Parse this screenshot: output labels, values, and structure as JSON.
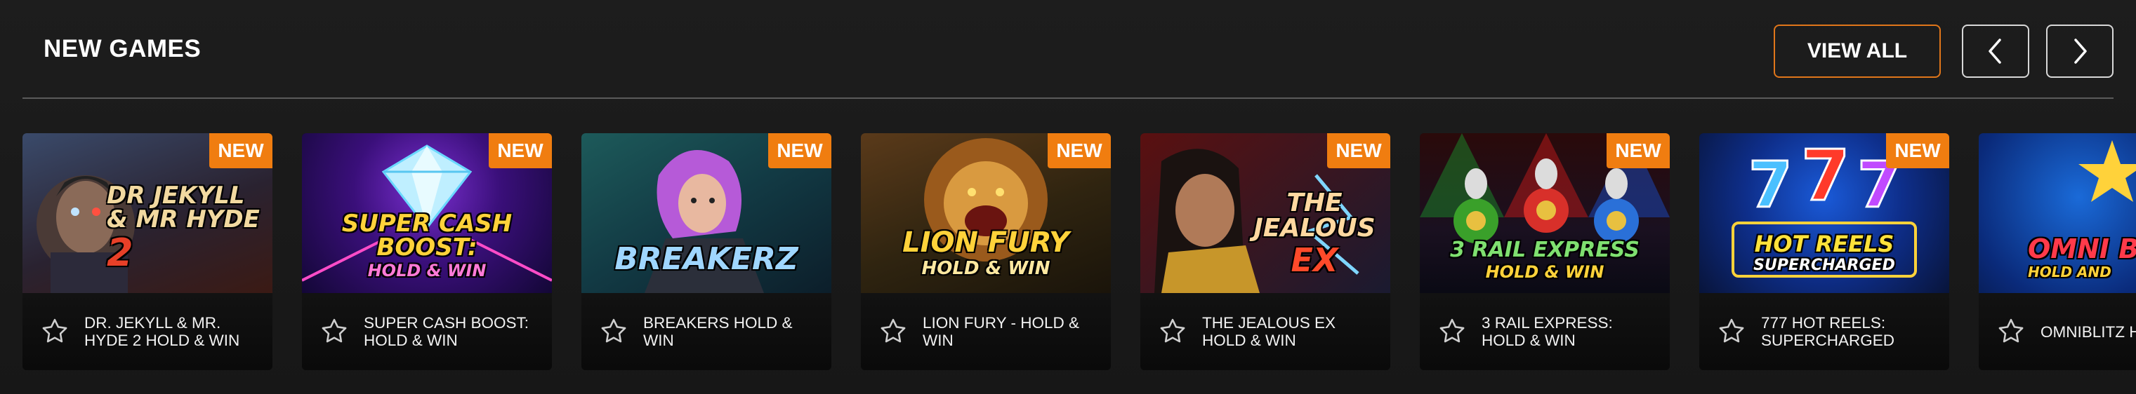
{
  "section": {
    "title": "NEW GAMES",
    "view_all_label": "VIEW ALL",
    "prev_icon": "chevron-left-icon",
    "next_icon": "chevron-right-icon"
  },
  "colors": {
    "accent": "#f07d10",
    "background": "#1a1a1a",
    "card": "#0c0c0c"
  },
  "games": [
    {
      "name": "DR. JEKYLL & MR. HYDE 2 HOLD & WIN",
      "badge": "NEW",
      "art_title": "DR JEKYLL & MR HYDE",
      "art_subtitle": "2",
      "favorite_icon": "star-outline-icon"
    },
    {
      "name": "SUPER CASH BOOST: HOLD & WIN",
      "badge": "NEW",
      "art_title": "SUPER CASH BOOST:",
      "art_subtitle": "HOLD & WIN",
      "favorite_icon": "star-outline-icon"
    },
    {
      "name": "BREAKERS HOLD & WIN",
      "badge": "NEW",
      "art_title": "BREAKERZ",
      "art_subtitle": "",
      "favorite_icon": "star-outline-icon"
    },
    {
      "name": "LION FURY - HOLD & WIN",
      "badge": "NEW",
      "art_title": "LION FURY",
      "art_subtitle": "HOLD & WIN",
      "favorite_icon": "star-outline-icon"
    },
    {
      "name": "THE JEALOUS EX HOLD & WIN",
      "badge": "NEW",
      "art_title": "THE JEALOUS",
      "art_subtitle": "EX",
      "favorite_icon": "star-outline-icon"
    },
    {
      "name": "3 RAIL EXPRESS: HOLD & WIN",
      "badge": "NEW",
      "art_title": "3 RAIL EXPRESS",
      "art_subtitle": "HOLD & WIN",
      "favorite_icon": "star-outline-icon"
    },
    {
      "name": "777 HOT REELS: SUPERCHARGED",
      "badge": "NEW",
      "art_title": "HOT REELS",
      "art_subtitle": "SUPERCHARGED",
      "favorite_icon": "star-outline-icon"
    },
    {
      "name": "OMNIBLITZ HOLD AND",
      "badge": "",
      "art_title": "OMNI BLITZ",
      "art_subtitle": "HOLD AND",
      "favorite_icon": "star-outline-icon"
    }
  ]
}
